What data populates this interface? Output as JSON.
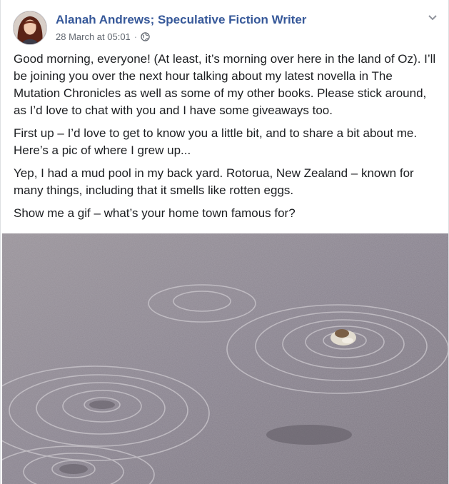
{
  "post": {
    "author": "Alanah Andrews; Speculative Fiction Writer",
    "timestamp": "28 March at 05:01",
    "separator": "·",
    "privacy_icon": "globe-icon",
    "menu_icon": "chevron-down-icon",
    "paragraphs": [
      "Good morning, everyone! (At least, it’s morning over here in the land of Oz). I’ll be joining you over the next hour talking about my latest novella in The Mutation Chronicles as well as some of my other books. Please stick around, as I’d love to chat with you and I have some giveaways too.",
      "First up – I’d love to get to know you a little bit, and to share a bit about me. Here’s a pic of where I grew up...",
      "Yep, I had a mud pool in my back yard. Rotorua, New Zealand – known for many things, including that it smells like rotten eggs.",
      "Show me a gif – what’s your home town famous for?"
    ]
  },
  "colors": {
    "author_link": "#365899",
    "meta_text": "#616770",
    "body_text": "#1c1e21",
    "mud": "#8d8790"
  }
}
